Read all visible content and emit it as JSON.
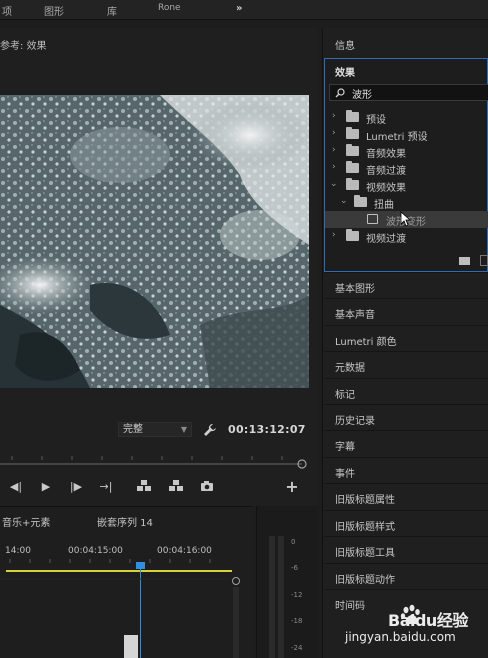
{
  "menu": {
    "items": [
      "项",
      "图形",
      "库",
      "Rone"
    ],
    "more": "»"
  },
  "monitor": {
    "title": "参考: 效果",
    "fit_value": "完整",
    "timecode": "00:13:12:07"
  },
  "timeline": {
    "tab1": "音乐+元素",
    "tab2": "嵌套序列 14",
    "time_marks": [
      "14:00",
      "00:04:15:00",
      "00:04:16:00"
    ]
  },
  "audio_meter": {
    "labels": [
      "0",
      "-6",
      "-12",
      "-18",
      "-24"
    ]
  },
  "right_panel": {
    "info_title": "信息",
    "effects_title": "效果",
    "search_value": "波形",
    "tree": [
      {
        "label": "预设",
        "level": 0,
        "expanded": false
      },
      {
        "label": "Lumetri 预设",
        "level": 0,
        "expanded": false
      },
      {
        "label": "音频效果",
        "level": 0,
        "expanded": false
      },
      {
        "label": "音频过渡",
        "level": 0,
        "expanded": false
      },
      {
        "label": "视频效果",
        "level": 0,
        "expanded": true
      },
      {
        "label": "扭曲",
        "level": 1,
        "expanded": true
      },
      {
        "label": "波形变形",
        "level": 2,
        "expanded": false
      },
      {
        "label": "视频过渡",
        "level": 0,
        "expanded": false
      }
    ],
    "panels": [
      "基本图形",
      "基本声音",
      "Lumetri 颜色",
      "元数据",
      "标记",
      "历史记录",
      "字幕",
      "事件",
      "旧版标题属性",
      "旧版标题样式",
      "旧版标题工具",
      "旧版标题动作",
      "时间码"
    ]
  },
  "watermark": {
    "brand": "Baidu经验",
    "url": "jingyan.baidu.com"
  },
  "colors": {
    "accent_blue": "#2d6db5",
    "playhead_blue": "#2f8fe0",
    "work_area_yellow": "#d7d43a"
  }
}
